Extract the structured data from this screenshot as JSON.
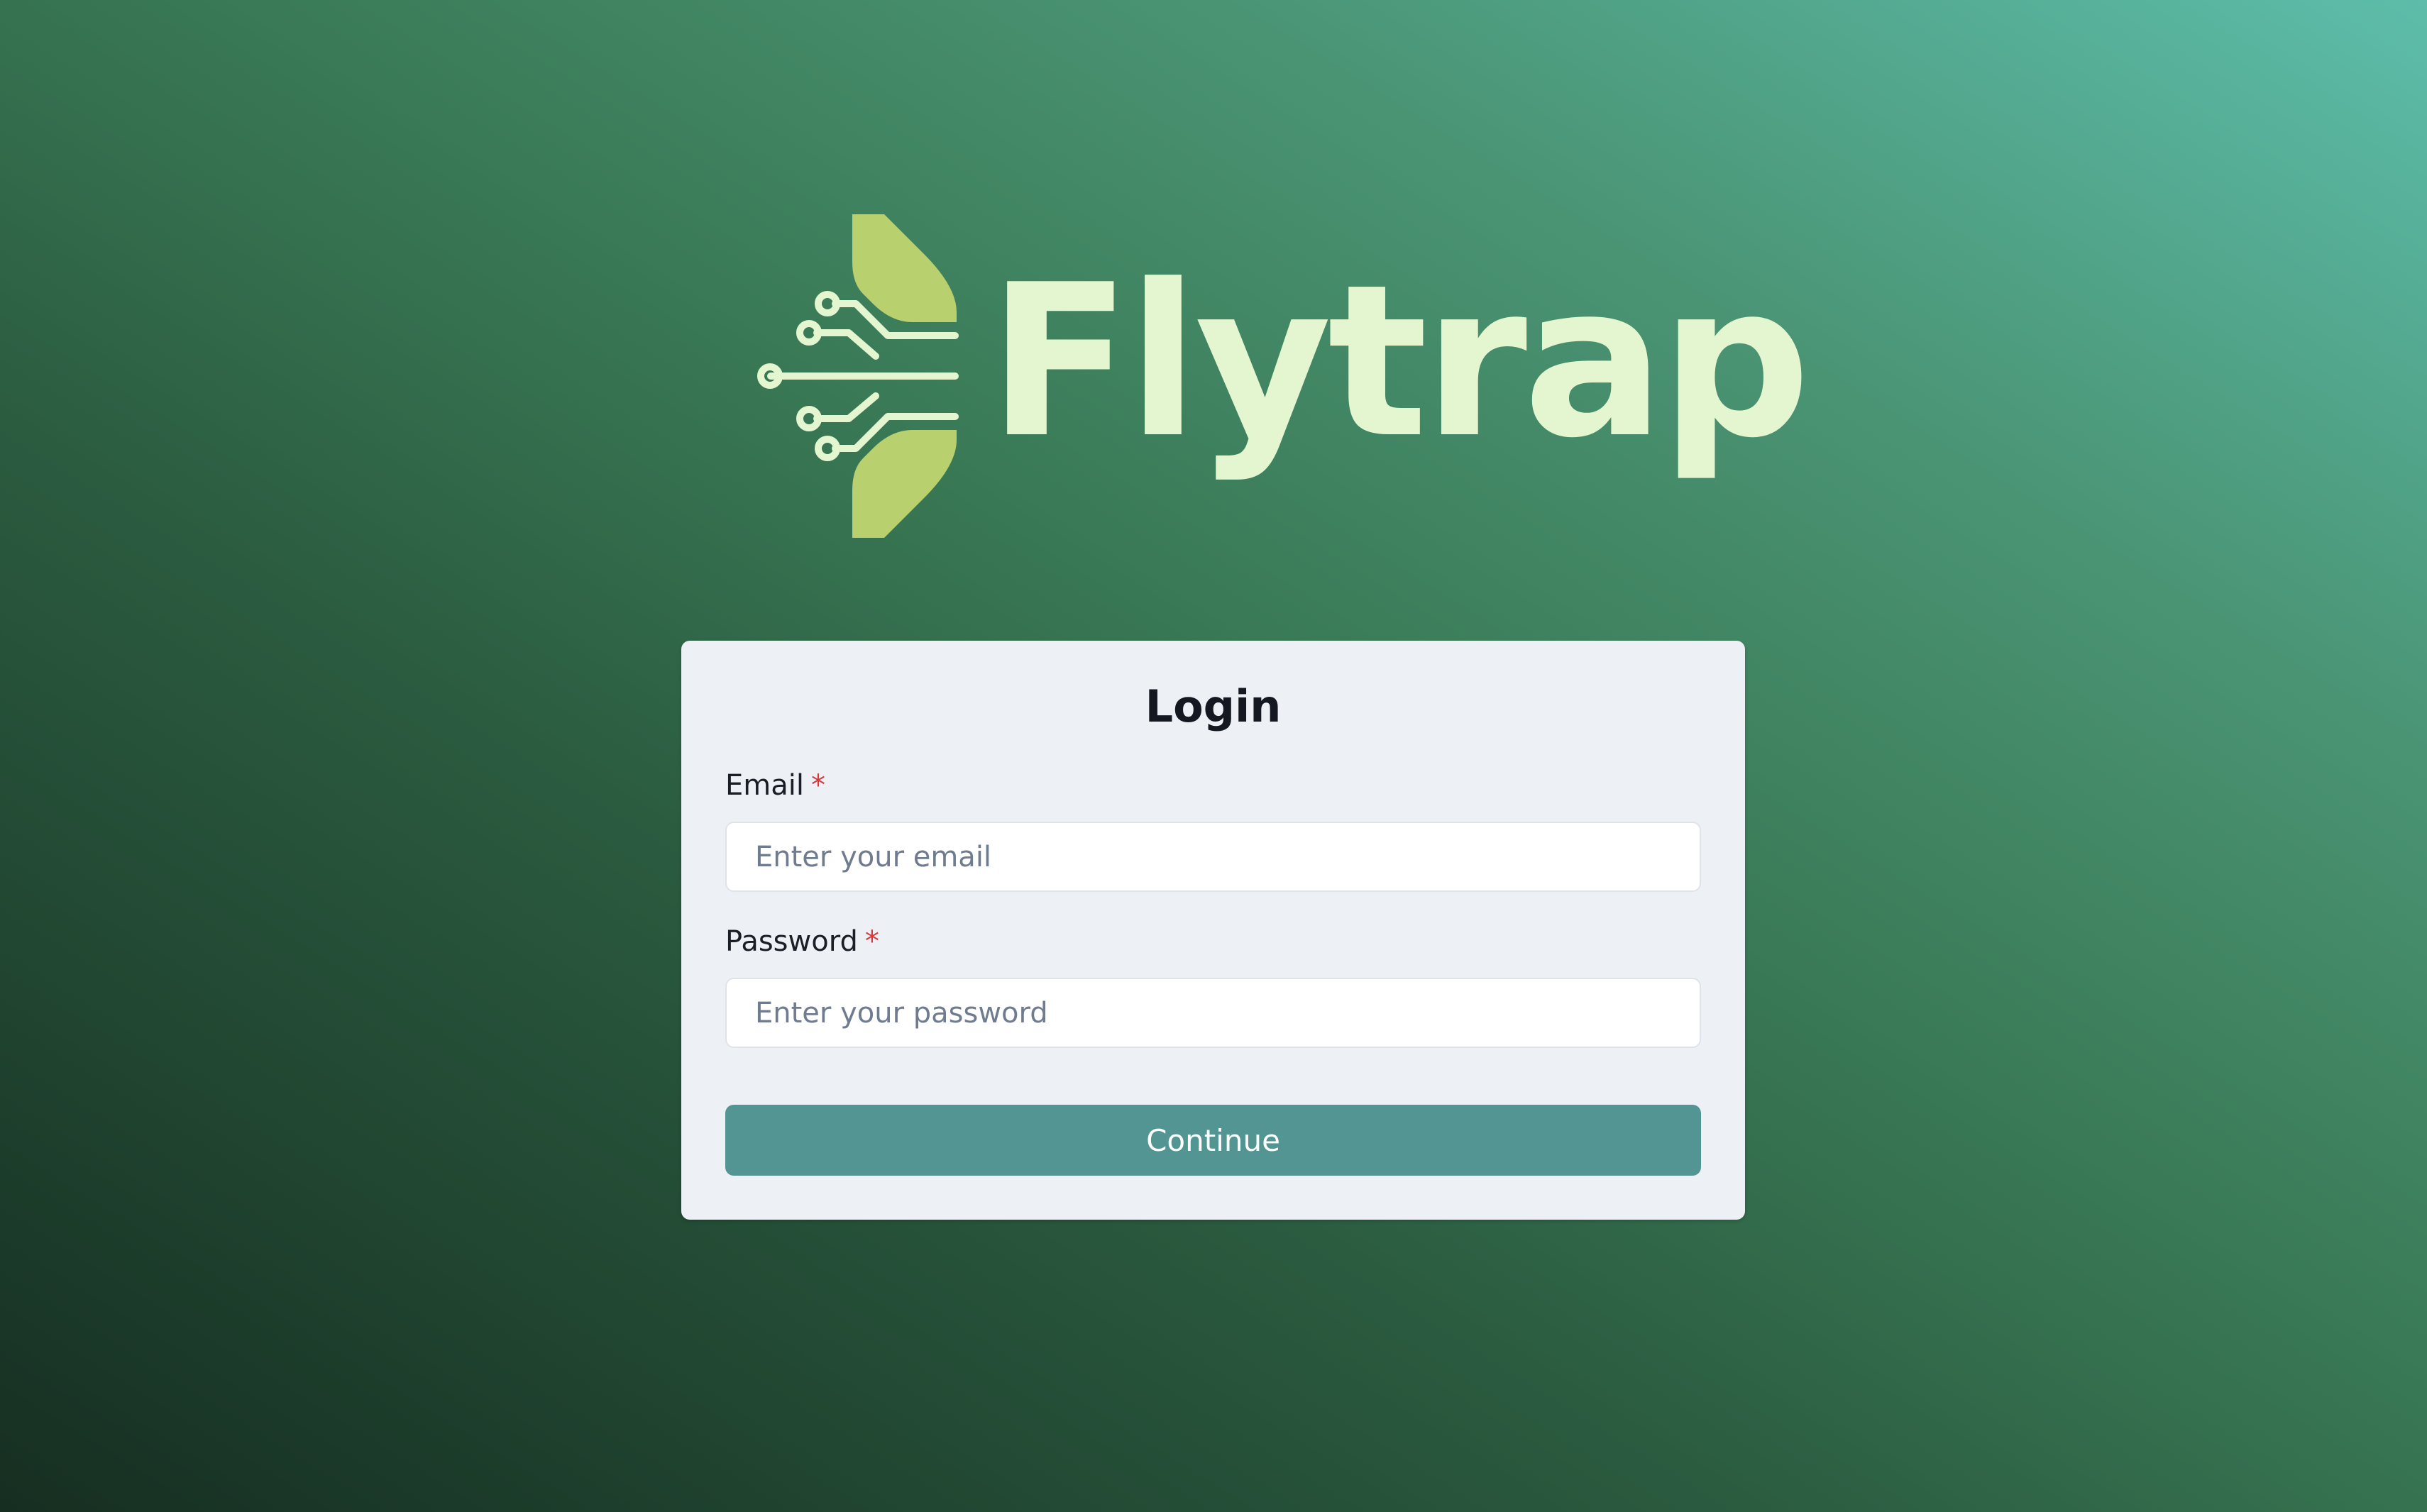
{
  "app": {
    "brand_name": "Flytrap"
  },
  "colors": {
    "leaf": "#b8d06e",
    "brand_text": "#e4f6cf",
    "button": "#529592",
    "required_marker": "#d9383c",
    "card_background": "#edf0f4"
  },
  "icons": {
    "logo": "flytrap-leaf-circuit-logo"
  },
  "login": {
    "title": "Login",
    "email": {
      "label": "Email",
      "required_marker": "*",
      "value": "",
      "placeholder": "Enter your email"
    },
    "password": {
      "label": "Password",
      "required_marker": "*",
      "value": "",
      "placeholder": "Enter your password"
    },
    "continue_label": "Continue"
  }
}
